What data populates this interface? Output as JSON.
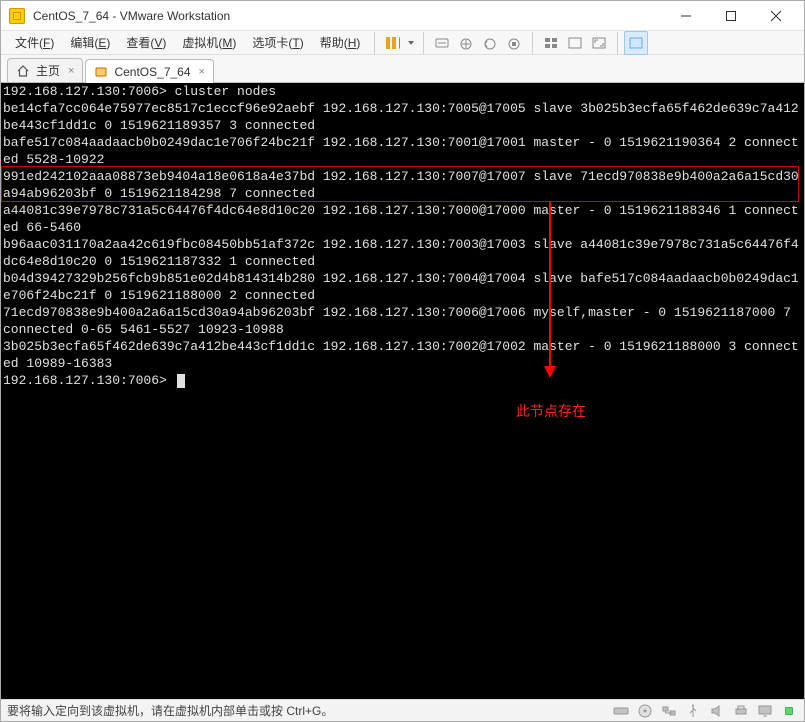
{
  "window": {
    "title": "CentOS_7_64 - VMware Workstation"
  },
  "menubar": {
    "items": [
      {
        "label_pre": "文件(",
        "key": "F",
        "label_post": ")"
      },
      {
        "label_pre": "编辑(",
        "key": "E",
        "label_post": ")"
      },
      {
        "label_pre": "查看(",
        "key": "V",
        "label_post": ")"
      },
      {
        "label_pre": "虚拟机(",
        "key": "M",
        "label_post": ")"
      },
      {
        "label_pre": "选项卡(",
        "key": "T",
        "label_post": ")"
      },
      {
        "label_pre": "帮助(",
        "key": "H",
        "label_post": ")"
      }
    ]
  },
  "tabs": {
    "home_label": "主页",
    "vm_label": "CentOS_7_64"
  },
  "terminal": {
    "text": "192.168.127.130:7006> cluster nodes\nbe14cfa7cc064e75977ec8517c1eccf96e92aebf 192.168.127.130:7005@17005 slave 3b025b3ecfa65f462de639c7a412be443cf1dd1c 0 1519621189357 3 connected\nbafe517c084aadaacb0b0249dac1e706f24bc21f 192.168.127.130:7001@17001 master - 0 1519621190364 2 connected 5528-10922\n991ed242102aaa08873eb9404a18e0618a4e37bd 192.168.127.130:7007@17007 slave 71ecd970838e9b400a2a6a15cd30a94ab96203bf 0 1519621184298 7 connected\na44081c39e7978c731a5c64476f4dc64e8d10c20 192.168.127.130:7000@17000 master - 0 1519621188346 1 connected 66-5460\nb96aac031170a2aa42c619fbc08450bb51af372c 192.168.127.130:7003@17003 slave a44081c39e7978c731a5c64476f4dc64e8d10c20 0 1519621187332 1 connected\nb04d39427329b256fcb9b851e02d4b814314b280 192.168.127.130:7004@17004 slave bafe517c084aadaacb0b0249dac1e706f24bc21f 0 1519621188000 2 connected\n71ecd970838e9b400a2a6a15cd30a94ab96203bf 192.168.127.130:7006@17006 myself,master - 0 1519621187000 7 connected 0-65 5461-5527 10923-10988\n3b025b3ecfa65f462de639c7a412be443cf1dd1c 192.168.127.130:7002@17002 master - 0 1519621188000 3 connected 10989-16383\n192.168.127.130:7006> ",
    "annotation": "此节点存在"
  },
  "statusbar": {
    "hint": "要将输入定向到该虚拟机，请在虚拟机内部单击或按 Ctrl+G。"
  }
}
